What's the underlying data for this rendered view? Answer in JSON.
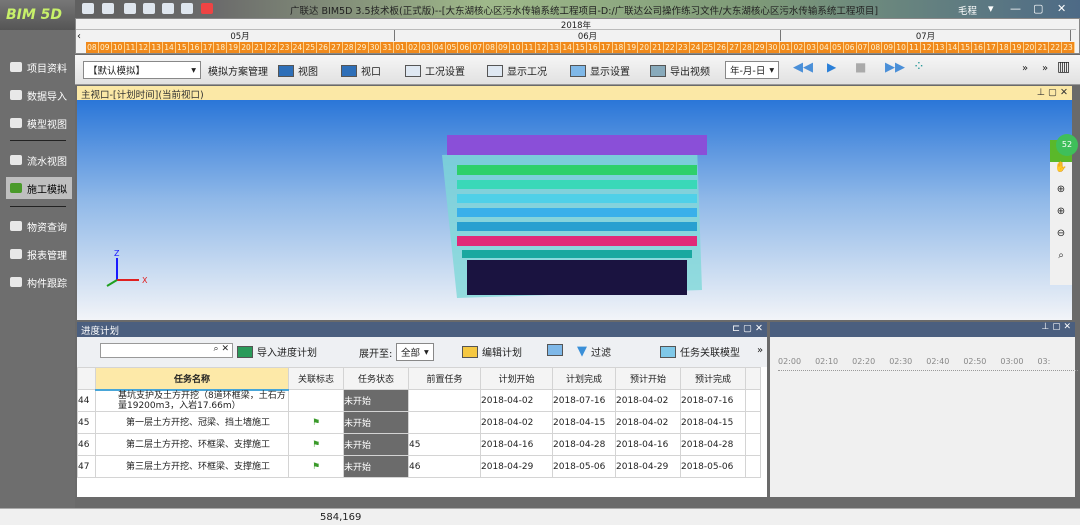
{
  "app": {
    "logo": "BIM 5D",
    "title": "广联达 BIM5D 3.5技术板(正式版)--[大东湖核心区污水传输系统工程项目-D:/广联达公司操作练习文件/大东湖核心区污水传输系统工程项目]",
    "user": "毛程"
  },
  "timeline": {
    "year": "2018年",
    "months": [
      "05月",
      "06月",
      "07月"
    ],
    "days": [
      "08",
      "09",
      "10",
      "11",
      "12",
      "13",
      "14",
      "15",
      "16",
      "17",
      "18",
      "19",
      "20",
      "21",
      "22",
      "23",
      "24",
      "25",
      "26",
      "27",
      "28",
      "29",
      "30",
      "31",
      "01",
      "02",
      "03",
      "04",
      "05",
      "06",
      "07",
      "08",
      "09",
      "10",
      "11",
      "12",
      "13",
      "14",
      "15",
      "16",
      "17",
      "18",
      "19",
      "20",
      "21",
      "22",
      "23",
      "24",
      "25",
      "26",
      "27",
      "28",
      "29",
      "30",
      "01",
      "02",
      "03",
      "04",
      "05",
      "06",
      "07",
      "08",
      "09",
      "10",
      "11",
      "12",
      "13",
      "14",
      "15",
      "16",
      "17",
      "18",
      "19",
      "20",
      "21",
      "22",
      "23"
    ]
  },
  "sidebar": [
    "项目资料",
    "数据导入",
    "模型视图",
    "流水视图",
    "施工模拟",
    "物资查询",
    "报表管理",
    "构件跟踪"
  ],
  "toolbar": {
    "scheme": "【默认模拟】",
    "manage": "模拟方案管理",
    "view": "视图",
    "viewport": "视口",
    "condition": "工况设置",
    "show_condition": "显示工况",
    "display": "显示设置",
    "export": "导出视频",
    "date_format": "年-月-日"
  },
  "viewport": {
    "title": "主视口-[计划时间](当前视口)",
    "badge": "52"
  },
  "schedule": {
    "title": "进度计划",
    "import": "导入进度计划",
    "expand_label": "展开至:",
    "expand_value": "全部",
    "edit": "编辑计划",
    "filter": "过滤",
    "link": "任务关联模型",
    "columns": [
      "任务名称",
      "关联标志",
      "任务状态",
      "前置任务",
      "计划开始",
      "计划完成",
      "预计开始",
      "预计完成"
    ],
    "rows": [
      {
        "no": "44",
        "name": "基坑支护及土方开挖（8道环框梁，土石方量19200m3，入岩17.66m）",
        "status": "未开始",
        "pre": "",
        "ps": "2018-04-02",
        "pe": "2018-07-16",
        "es": "2018-04-02",
        "ee": "2018-07-16"
      },
      {
        "no": "45",
        "name": "第一层土方开挖、冠梁、挡土墙施工",
        "status": "未开始",
        "pre": "",
        "ps": "2018-04-02",
        "pe": "2018-04-15",
        "es": "2018-04-02",
        "ee": "2018-04-15"
      },
      {
        "no": "46",
        "name": "第二层土方开挖、环框梁、支撑施工",
        "status": "未开始",
        "pre": "45",
        "ps": "2018-04-16",
        "pe": "2018-04-28",
        "es": "2018-04-16",
        "ee": "2018-04-28"
      },
      {
        "no": "47",
        "name": "第三层土方开挖、环框梁、支撑施工",
        "status": "未开始",
        "pre": "46",
        "ps": "2018-04-29",
        "pe": "2018-05-06",
        "es": "2018-04-29",
        "ee": "2018-05-06"
      }
    ]
  },
  "ruler": [
    "02:00",
    "02:10",
    "02:20",
    "02:30",
    "02:40",
    "02:50",
    "03:00",
    "03:"
  ],
  "status": {
    "coords": "584,169"
  }
}
